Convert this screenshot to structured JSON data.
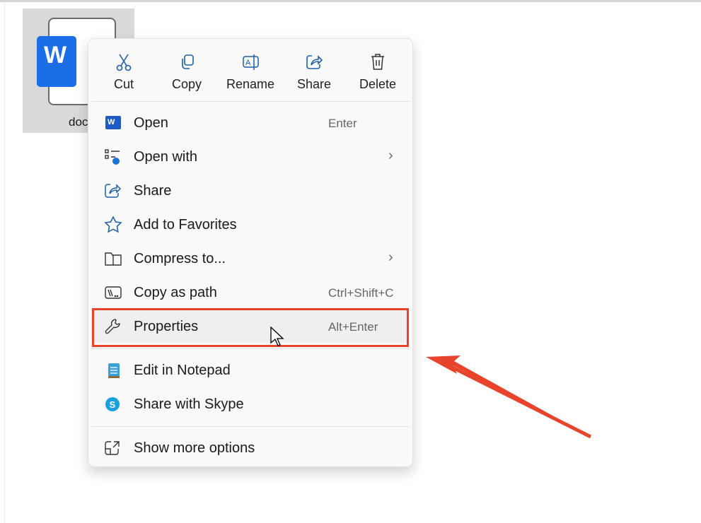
{
  "file": {
    "name": "doc"
  },
  "toolbar": [
    {
      "label": "Cut",
      "icon": "scissors-icon"
    },
    {
      "label": "Copy",
      "icon": "copy-icon"
    },
    {
      "label": "Rename",
      "icon": "rename-icon"
    },
    {
      "label": "Share",
      "icon": "share-icon"
    },
    {
      "label": "Delete",
      "icon": "trash-icon"
    }
  ],
  "items": [
    {
      "label": "Open",
      "shortcut": "Enter"
    },
    {
      "label": "Open with"
    },
    {
      "label": "Share"
    },
    {
      "label": "Add to Favorites"
    },
    {
      "label": "Compress to..."
    },
    {
      "label": "Copy as path",
      "shortcut": "Ctrl+Shift+C"
    },
    {
      "label": "Properties",
      "shortcut": "Alt+Enter"
    },
    {
      "label": "Edit in Notepad"
    },
    {
      "label": "Share with Skype"
    },
    {
      "label": "Show more options"
    }
  ],
  "colors": {
    "highlight": "#e8432b",
    "accent": "#1c6ee8"
  }
}
